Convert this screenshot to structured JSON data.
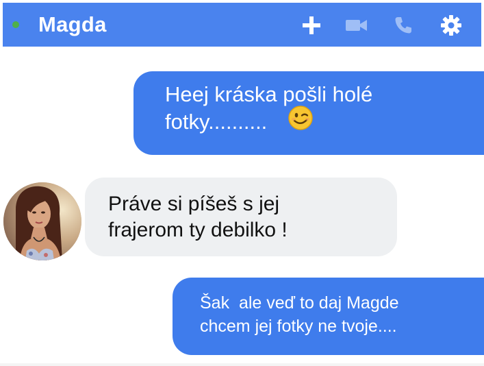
{
  "header": {
    "contact_name": "Magda",
    "status": "online",
    "icons": [
      "add-icon",
      "video-call-icon",
      "phone-call-icon",
      "settings-gear-icon"
    ]
  },
  "messages": [
    {
      "direction": "outgoing",
      "lines": [
        "Heej kráska pošli holé",
        "fotky.........."
      ],
      "emoji": "winking-face-emoji"
    },
    {
      "direction": "incoming",
      "lines": [
        "Práve si píšeš s jej",
        "frajerom ty debilko !"
      ],
      "avatar": "contact-avatar"
    },
    {
      "direction": "outgoing",
      "lines": [
        "Šak  ale veď to daj Magde",
        "chcem jej fotky ne tvoje...."
      ]
    }
  ],
  "colors": {
    "header_bg": "#4a83ee",
    "outgoing_bubble": "#3f7cec",
    "incoming_bubble": "#eef0f2",
    "online_dot": "#4fb04a"
  }
}
